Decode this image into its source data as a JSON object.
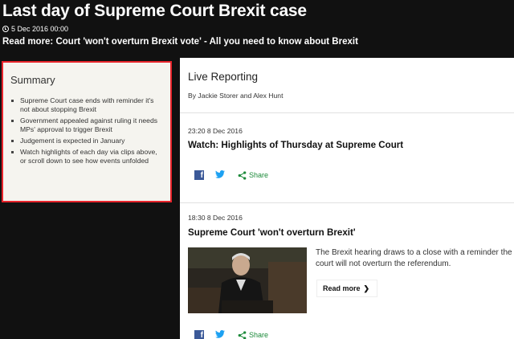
{
  "header": {
    "title": "Last day of Supreme Court Brexit case",
    "date": "5 Dec 2016 00:00",
    "read_more": "Read more: Court 'won't overturn Brexit vote' - All you need to know about Brexit"
  },
  "summary": {
    "title": "Summary",
    "items": [
      "Supreme Court case ends with reminder it's not about stopping Brexit",
      "Government appealed against ruling it needs MPs' approval to trigger Brexit",
      "Judgement is expected in January",
      "Watch highlights of each day via clips above, or scroll down to see how events unfolded"
    ]
  },
  "live": {
    "title": "Live Reporting",
    "byline": "By Jackie Storer and Alex Hunt"
  },
  "posts": [
    {
      "time": "23:20  8 Dec  2016",
      "title": "Watch: Highlights of Thursday at Supreme Court",
      "share_label": "Share"
    },
    {
      "time": "18:30  8 Dec  2016",
      "title": "Supreme Court 'won't overturn Brexit'",
      "text": "The Brexit hearing draws to a close with a reminder the court will not overturn the referendum.",
      "read_more_label": "Read more",
      "read_more_arrow": "❯",
      "share_label": "Share"
    }
  ],
  "colors": {
    "header_bg": "#111111",
    "summary_border": "#e8242b",
    "facebook": "#3b5998",
    "twitter": "#1da1f2",
    "share": "#1c8a3a"
  },
  "icons": {
    "date": "clock-icon",
    "facebook": "facebook-icon",
    "twitter": "twitter-icon",
    "share": "share-icon",
    "read_more": "chevron-right-icon"
  }
}
